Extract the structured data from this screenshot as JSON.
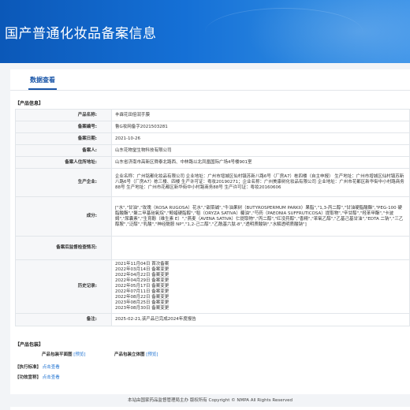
{
  "header": {
    "title": "国产普通化妆品备案信息"
  },
  "tab": {
    "label": "数据查看"
  },
  "product_info": {
    "section_title": "【产品信息】",
    "rows": [
      {
        "label": "产品名称:",
        "value": "丰霖花田倍润手膜"
      },
      {
        "label": "备案编号:",
        "value": "鲁G妆网备字2021503281"
      },
      {
        "label": "备案日期:",
        "value": "2021-10-26"
      },
      {
        "label": "备案人:",
        "value": "山东花物堂生物科技有限公司"
      },
      {
        "label": "备案人住所地址:",
        "value": "山东省济南市高新区舜泰北路西、中林路以北凤凰国际广场4号楼901室"
      },
      {
        "label": "生产企业:",
        "value": "企业名称：广州铭都化妆品有限公司 企业地址：广州市增城区仙村镇苏新八路6号（厂房A7）栋四楼（自主申报） 生产地址：广州市增城区仙村镇苏新八路6号（厂房A7）栋三楼、四楼 生产许可证：粤妆20190271；企业名称：广州美康树化妆品有限公司 企业地址：广州市花都区新华街中小村路商务88号 生产地址：广州市花都区新华街中小村路商务88号 生产许可证：粤妆20160606"
      },
      {
        "label": "成分:",
        "value": "[\"水\",\"甘油\",\"玫瑰（ROSA RUGOSA）花水\",\"甜菜碱\",\"牛油果树（BUTYROSPERMUM PARKII）果脂\",\"1,3-丙二醇\",\"甘油硬脂酸酯\",\"PEG-100 硬脂酸酯\",\"聚二甲基硅氧烷\",\"鲸蜡硬脂醇\",\"稻（ORYZA SATIVA）糠油\",\"芍药（PAEONIA SUFFRUTICOSA）提取物\",\"辛甘醇\",\"羟苯甲酯\",\"卡波姆\",\"尿囊素\",\"生育酚（维生素 E）\",\"燕麦（AVENA SATIVA）仁提取物\",\"丙二醇\",\"红没药醇\",\"香精\",\"苯氧乙醇\",\"乙基己基甘油\",\"EDTA 二钠\",\"三乙醇胺\",\"泛醇\",\"乳酸\",\"神经酰胺 NP\",\"1,2-己二醇\",\"乙酰基六肽-8\",\"透明质酸钠\",\"水解透明质酸钠\"]"
      },
      {
        "label": "备案后监督检查情况:",
        "value": ""
      },
      {
        "label": "历史记录:",
        "lines": [
          "2021年11月04日 首次备案",
          "2022年03月14日 备案变更",
          "2022年04月22日 备案变更",
          "2022年04月29日 备案变更",
          "2022年05月17日 备案变更",
          "2022年07月11日 备案变更",
          "2022年08月22日 备案变更",
          "2023年08月25日 备案变更",
          "2023年08月30日 备案变更"
        ]
      },
      {
        "label": "备注:",
        "value": "2025-02-21,该产品已完成2024年度报告"
      }
    ]
  },
  "package": {
    "section_title": "【产品包装】",
    "flat_label": "产品包装平面图",
    "flat_link": "[预览]",
    "stand_label": "产品包装立体图",
    "stand_link": "[预览]"
  },
  "standard": {
    "section_title": "【执行标准】",
    "link": "点击查看"
  },
  "efficacy": {
    "section_title": "【功效宣称】",
    "link": "点击查看"
  },
  "footer": {
    "text": "本站由国家药品监督管理局主办 版权所有 Copyright © NMPA All Rights Reserved"
  }
}
